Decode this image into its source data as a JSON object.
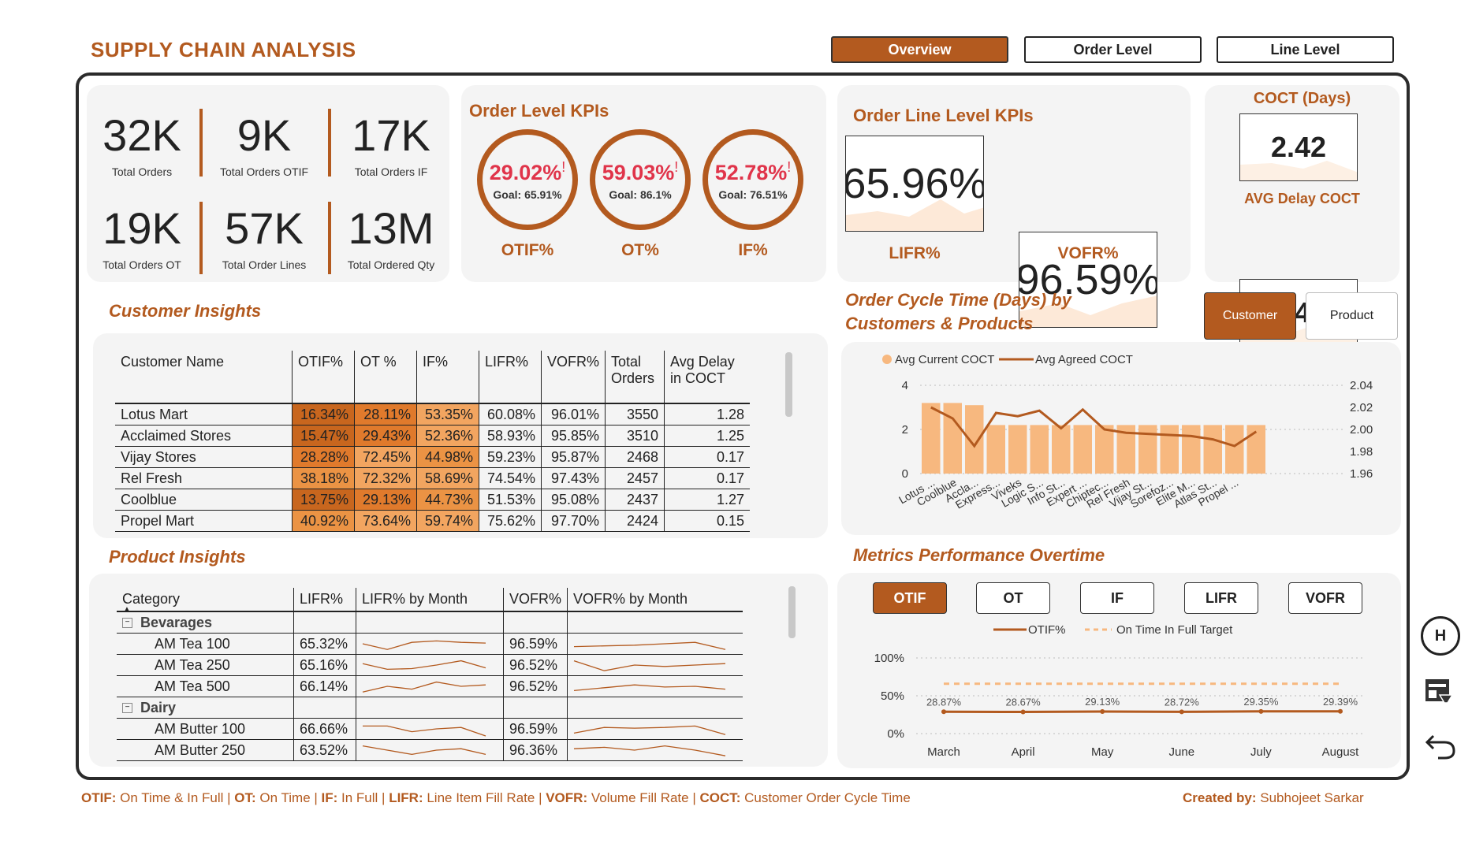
{
  "header": {
    "title": "SUPPLY CHAIN ANALYSIS"
  },
  "nav": [
    {
      "label": "Overview",
      "active": true
    },
    {
      "label": "Order Level",
      "active": false
    },
    {
      "label": "Line Level",
      "active": false
    }
  ],
  "summary": [
    {
      "value": "32K",
      "label": "Total Orders"
    },
    {
      "value": "9K",
      "label": "Total Orders OTIF"
    },
    {
      "value": "17K",
      "label": "Total Orders IF"
    },
    {
      "value": "19K",
      "label": "Total Orders OT"
    },
    {
      "value": "57K",
      "label": "Total Order Lines"
    },
    {
      "value": "13M",
      "label": "Total Ordered Qty"
    }
  ],
  "order_kpis": {
    "title": "Order Level KPIs",
    "items": [
      {
        "value": "29.02%",
        "flag": "!",
        "goal": "Goal: 65.91%",
        "name": "OTIF%"
      },
      {
        "value": "59.03%",
        "flag": "!",
        "goal": "Goal: 86.1%",
        "name": "OT%"
      },
      {
        "value": "52.78%",
        "flag": "!",
        "goal": "Goal: 76.51%",
        "name": "IF%"
      }
    ]
  },
  "line_kpis": {
    "title": "Order Line Level KPIs",
    "items": [
      {
        "value": "65.96%",
        "name": "LIFR%"
      },
      {
        "value": "96.59%",
        "name": "VOFR%"
      }
    ]
  },
  "coct": {
    "title": "COCT (Days)",
    "value": "2.42",
    "delay_title": "AVG Delay COCT",
    "delay_value": "0.42"
  },
  "customer_insights": {
    "title": "Customer Insights",
    "columns": [
      "Customer Name",
      "OTIF%",
      "OT %",
      "IF%",
      "LIFR%",
      "VOFR%",
      "Total Orders",
      "Avg Delay in COCT"
    ],
    "rows": [
      [
        "Lotus Mart",
        "16.34%",
        "28.11%",
        "53.35%",
        "60.08%",
        "96.01%",
        "3550",
        "1.28"
      ],
      [
        "Acclaimed Stores",
        "15.47%",
        "29.43%",
        "52.36%",
        "58.93%",
        "95.85%",
        "3510",
        "1.25"
      ],
      [
        "Vijay Stores",
        "28.28%",
        "72.45%",
        "44.98%",
        "59.23%",
        "95.87%",
        "2468",
        "0.17"
      ],
      [
        "Rel Fresh",
        "38.18%",
        "72.32%",
        "58.69%",
        "74.54%",
        "97.43%",
        "2457",
        "0.17"
      ],
      [
        "Coolblue",
        "13.75%",
        "29.13%",
        "44.73%",
        "51.53%",
        "95.08%",
        "2437",
        "1.27"
      ],
      [
        "Propel Mart",
        "40.92%",
        "73.64%",
        "59.74%",
        "75.62%",
        "97.70%",
        "2424",
        "0.15"
      ]
    ]
  },
  "product_insights": {
    "title": "Product Insights",
    "columns": [
      "Category",
      "LIFR%",
      "LIFR% by Month",
      "VOFR%",
      "VOFR% by Month"
    ],
    "rows": [
      {
        "type": "group",
        "name": "Bevarages"
      },
      {
        "type": "item",
        "name": "AM Tea 100",
        "lifr": "65.32%",
        "vofr": "96.59%",
        "s1": [
          0.5,
          0.1,
          0.6,
          0.7,
          0.6,
          0.55
        ],
        "s2": [
          0.3,
          0.35,
          0.4,
          0.5,
          0.6,
          0.1
        ]
      },
      {
        "type": "item",
        "name": "AM Tea 250",
        "lifr": "65.16%",
        "vofr": "96.52%",
        "s1": [
          0.6,
          0.2,
          0.25,
          0.5,
          0.8,
          0.3
        ],
        "s2": [
          0.8,
          0.1,
          0.5,
          0.4,
          0.5,
          0.6
        ]
      },
      {
        "type": "item",
        "name": "AM Tea 500",
        "lifr": "66.14%",
        "vofr": "96.52%",
        "s1": [
          0.1,
          0.5,
          0.3,
          0.8,
          0.5,
          0.6
        ],
        "s2": [
          0.2,
          0.4,
          0.6,
          0.45,
          0.5,
          0.3
        ]
      },
      {
        "type": "group",
        "name": "Dairy"
      },
      {
        "type": "item",
        "name": "AM Butter 100",
        "lifr": "66.66%",
        "vofr": "96.59%",
        "s1": [
          0.7,
          0.7,
          0.3,
          0.5,
          0.6,
          0.0
        ],
        "s2": [
          0.2,
          0.6,
          0.55,
          0.6,
          0.7,
          0.1
        ]
      },
      {
        "type": "item",
        "name": "AM Butter 250",
        "lifr": "63.52%",
        "vofr": "96.36%",
        "s1": [
          0.8,
          0.5,
          0.2,
          0.5,
          0.6,
          0.2
        ],
        "s2": [
          0.6,
          0.7,
          0.5,
          0.8,
          0.5,
          0.1
        ]
      }
    ]
  },
  "coct_chart": {
    "title_line1": "Order Cycle Time (Days) by",
    "title_line2": "Customers & Products",
    "toggle": [
      {
        "label": "Customer",
        "active": true
      },
      {
        "label": "Product",
        "active": false
      }
    ]
  },
  "metrics_chart": {
    "title": "Metrics Performance Overtime",
    "buttons": [
      {
        "label": "OTIF",
        "active": true
      },
      {
        "label": "OT",
        "active": false
      },
      {
        "label": "IF",
        "active": false
      },
      {
        "label": "LIFR",
        "active": false
      },
      {
        "label": "VOFR",
        "active": false
      }
    ]
  },
  "chart_data": [
    {
      "type": "bar",
      "series": [
        {
          "name": "Avg Current COCT",
          "values": [
            3.2,
            3.2,
            3.1,
            2.2,
            2.2,
            2.2,
            2.2,
            2.2,
            2.2,
            2.2,
            2.2,
            2.2,
            2.2,
            2.2,
            2.2,
            2.2
          ]
        },
        {
          "name": "Avg Agreed COCT",
          "values": [
            2.02,
            2.01,
            1.985,
            2.015,
            2.012,
            2.017,
            2.001,
            2.018,
            2.0,
            1.997,
            1.996,
            1.995,
            1.994,
            1.991,
            1.985,
            1.998
          ]
        }
      ],
      "categories": [
        "Lotus ...",
        "Coolblue",
        "Accla...",
        "Express...",
        "Viveks",
        "Logic S...",
        "Info St...",
        "Expert ...",
        "Chiptec...",
        "Rel Fresh",
        "Vijay St...",
        "Sorefoz...",
        "Elite M...",
        "Atlas St...",
        "Propel ...",
        ""
      ],
      "yticks": [
        "4",
        "2",
        "0"
      ],
      "y2ticks": [
        "2.04",
        "2.02",
        "2.00",
        "1.98",
        "1.96"
      ],
      "ylim": [
        0,
        4
      ],
      "y2lim": [
        1.96,
        2.04
      ],
      "legend": "top-left"
    },
    {
      "type": "line",
      "categories": [
        "March",
        "April",
        "May",
        "June",
        "July",
        "August"
      ],
      "series": [
        {
          "name": "OTIF%",
          "values": [
            28.87,
            28.67,
            29.13,
            28.72,
            29.35,
            29.39
          ],
          "labels": [
            "28.87%",
            "28.67%",
            "29.13%",
            "28.72%",
            "29.35%",
            "29.39%"
          ]
        },
        {
          "name": "On Time In Full Target",
          "values": [
            65.9,
            65.9,
            65.9,
            65.9,
            65.9,
            65.9
          ]
        }
      ],
      "yticks": [
        "100%",
        "50%",
        "0%"
      ],
      "ylim": [
        0,
        100
      ],
      "legend": "top"
    }
  ],
  "side_icons": {
    "h_label": "H"
  },
  "footer": {
    "defs": [
      {
        "key": "OTIF:",
        "val": " On Time & In Full | "
      },
      {
        "key": "OT:",
        "val": " On Time | "
      },
      {
        "key": "IF:",
        "val": " In Full | "
      },
      {
        "key": "LIFR:",
        "val": " Line Item Fill Rate | "
      },
      {
        "key": "VOFR:",
        "val": " Volume Fill Rate | "
      },
      {
        "key": "COCT:",
        "val": " Customer Order Cycle Time"
      }
    ],
    "credit_key": "Created by:",
    "credit_val": " Subhojeet Sarkar"
  },
  "colors": {
    "accent": "#b35a1f",
    "light_bar": "#f7b87f",
    "alert": "#e0344a",
    "card": "#f4f4f4"
  }
}
